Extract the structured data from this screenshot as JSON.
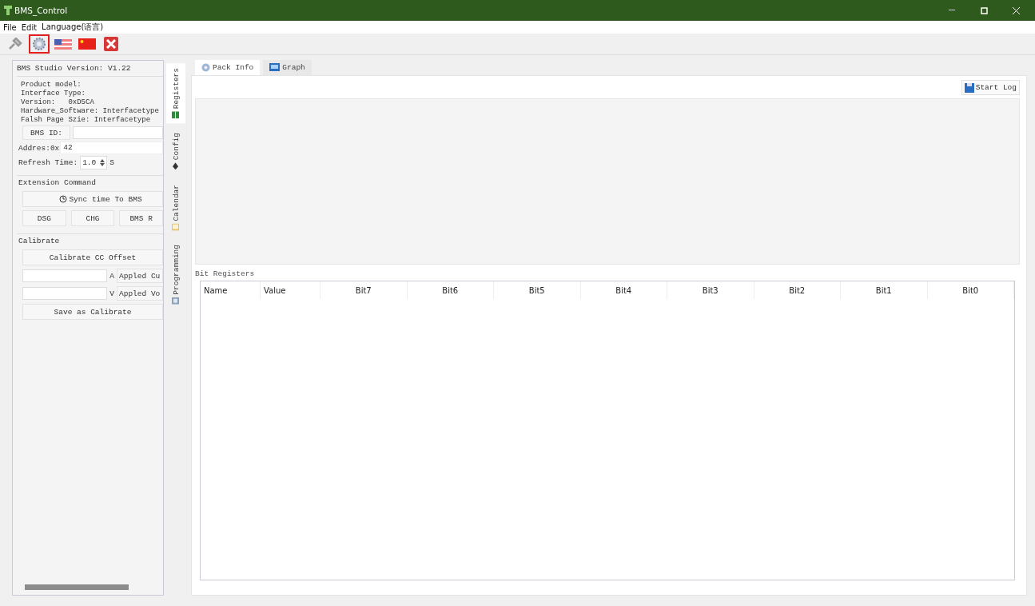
{
  "window": {
    "title": "BMS_Control"
  },
  "menu": [
    "File",
    "Edit",
    "Language(语言)"
  ],
  "toolbar": [
    {
      "kind": "connect",
      "selected": false
    },
    {
      "kind": "settings",
      "selected": true
    },
    {
      "kind": "flag_us",
      "selected": false
    },
    {
      "kind": "flag_cn",
      "selected": false
    },
    {
      "kind": "exit",
      "selected": false
    }
  ],
  "side_panel": {
    "version": "BMS Studio Version: V1.22",
    "info": [
      "Product model:",
      "Interface Type:",
      "Version:   0xD5CA",
      "Hardware_Software: Interfacetype",
      "Falsh Page Szie: Interfacetype"
    ],
    "bms_id_button": "BMS ID:",
    "address_label": "Addres:0x",
    "address_value": "42",
    "refresh_label": "Refresh Time:",
    "refresh_value": "1.0",
    "refresh_unit": "S",
    "extension_title": "Extension Command",
    "sync_button": "Sync time To BMS",
    "command_buttons": [
      "DSG",
      "CHG",
      "BMS R"
    ],
    "calibrate_title": "Calibrate",
    "calibrate_button": "Calibrate CC Offset",
    "current_unit": "A",
    "current_button": "Appled Cu",
    "voltage_unit": "V",
    "voltage_button": "Appled Vo",
    "save_button": "Save as Calibrate"
  },
  "vertical_tabs": [
    {
      "label": "Registers",
      "kind": "registers",
      "selected": true
    },
    {
      "label": "Config",
      "kind": "config",
      "selected": false
    },
    {
      "label": "Calendar",
      "kind": "calendar",
      "selected": false
    },
    {
      "label": "Programming",
      "kind": "programming",
      "selected": false
    }
  ],
  "tabs": [
    {
      "label": "Pack Info",
      "kind": "info",
      "selected": true
    },
    {
      "label": "Graph",
      "kind": "graph",
      "selected": false
    }
  ],
  "start_log_button": "Start Log",
  "bit_registers": {
    "title": "Bit Registers",
    "columns": [
      "Name",
      "Value",
      "Bit7",
      "Bit6",
      "Bit5",
      "Bit4",
      "Bit3",
      "Bit2",
      "Bit1",
      "Bit0"
    ]
  }
}
